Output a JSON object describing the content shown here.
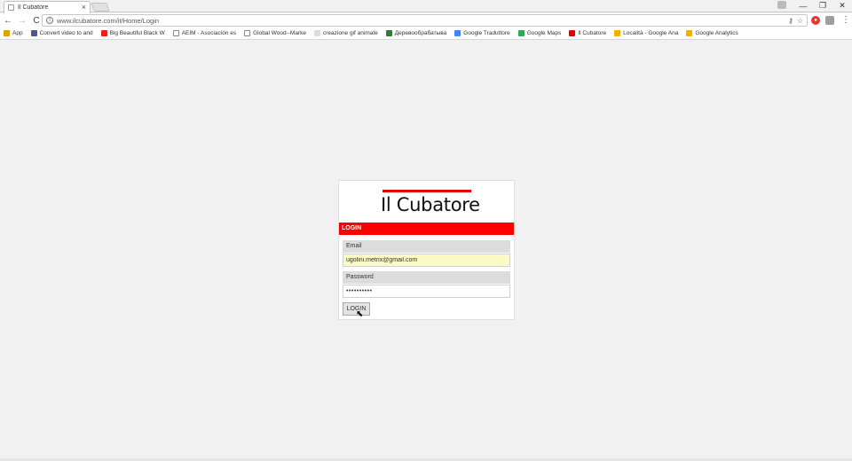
{
  "browser": {
    "tab_title": "Il Cubatore",
    "tab_close": "×",
    "url": "www.ilcubatore.com/it/Home/Login",
    "window_controls": [
      "—",
      "❐",
      "✕"
    ],
    "nav": {
      "back": "←",
      "forward": "→",
      "reload": "C"
    },
    "omnibox_icons": [
      "key-icon",
      "star-icon"
    ],
    "extensions": [
      {
        "name": "adblock-icon",
        "color": "#e53935"
      },
      {
        "name": "extension-icon",
        "color": "#9e9e9e"
      }
    ],
    "menu": "⋮"
  },
  "bookmarks": [
    {
      "label": "App",
      "icon": "apps-icon",
      "color": "#e0a000"
    },
    {
      "label": "Convert video to and",
      "icon": "convert-icon",
      "color": "#4a5a8a"
    },
    {
      "label": "Big Beautiful Black W",
      "icon": "youtube-icon",
      "color": "#e62117"
    },
    {
      "label": "AEIM - Asociación es",
      "icon": "page-icon",
      "color": "#ffffff"
    },
    {
      "label": "Global Wood--Marke",
      "icon": "page-icon",
      "color": "#ffffff"
    },
    {
      "label": "creazione gif animate",
      "icon": "gif-icon",
      "color": "#dddddd"
    },
    {
      "label": "Деревообрабатыва",
      "icon": "wood-icon",
      "color": "#2e7d32"
    },
    {
      "label": "Google Traduttore",
      "icon": "translate-icon",
      "color": "#4285f4"
    },
    {
      "label": "Google Maps",
      "icon": "maps-icon",
      "color": "#34a853"
    },
    {
      "label": "Il Cubatore",
      "icon": "cubatore-icon",
      "color": "#e00000"
    },
    {
      "label": "Località - Google Ana",
      "icon": "analytics-icon",
      "color": "#f9ab00"
    },
    {
      "label": "Google Analytics",
      "icon": "analytics-icon",
      "color": "#f9ab00"
    }
  ],
  "login": {
    "logo_text": "Il Cubatore",
    "header": "LOGIN",
    "email_label": "Email",
    "email_value": "ugolini.metrix@gmail.com",
    "password_label": "Password",
    "password_value": "••••••••••",
    "button_label": "LOGIN"
  },
  "colors": {
    "brand_red": "#ff0000",
    "autofill": "#fafac2"
  }
}
